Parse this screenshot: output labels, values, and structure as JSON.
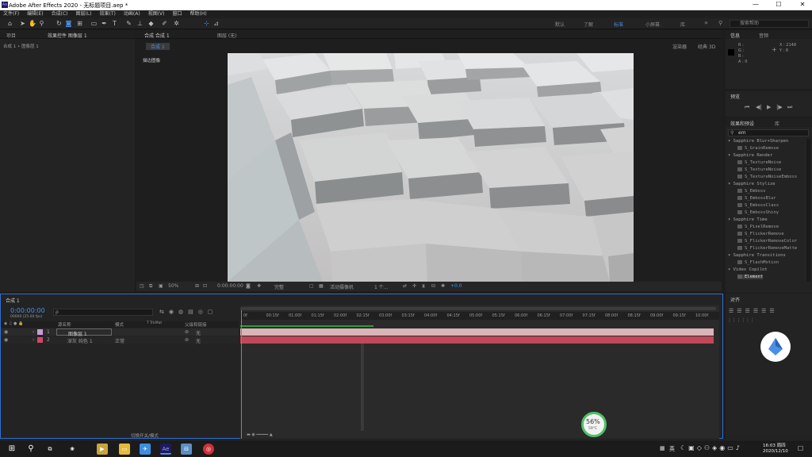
{
  "app": {
    "title": "Adobe After Effects 2020 - 无标题项目.aep *",
    "icon_text": "Ae",
    "minimize": "—",
    "maximize": "☐",
    "close": "✕"
  },
  "menu": [
    "文件(F)",
    "编辑(E)",
    "合成(C)",
    "图层(L)",
    "效果(T)",
    "动画(A)",
    "视图(V)",
    "窗口",
    "帮助(H)"
  ],
  "workspaces": [
    "默认",
    "了解",
    "标准",
    "小屏幕",
    "库"
  ],
  "search_help": {
    "placeholder": "搜索帮助"
  },
  "project": {
    "tab": "项目",
    "tab2": "效果控件 图像层 1",
    "breadcrumb": "合成 1 • 图像层 1"
  },
  "comp": {
    "tab_comp": "合成 合成 1",
    "tab_layer": "图层 (无)",
    "pill": "合成 1",
    "renderer_label": "渲染器",
    "renderer_value": "经典 3D",
    "layer_label": "描边图像"
  },
  "viewer_bar": {
    "zoom": "50%",
    "timecode": "0:00:00:00",
    "resolution": "完整",
    "camera": "活动摄像机",
    "views": "1 个...",
    "exposure": "+0.0"
  },
  "info": {
    "tab": "信息",
    "tab2": "音频",
    "r": "R :",
    "g": "G :",
    "b": "B :",
    "a": "A : 0",
    "x": "X : 2148",
    "y": "Y : 8"
  },
  "preview": {
    "tab": "预览"
  },
  "effects": {
    "tab": "效果和预设",
    "tab2": "库",
    "search_value": "em",
    "items": [
      {
        "type": "cat",
        "label": "Sapphire Blur+Sharpen"
      },
      {
        "type": "sub",
        "label": "S_GrainRemove"
      },
      {
        "type": "cat",
        "label": "Sapphire Render"
      },
      {
        "type": "sub",
        "label": "S_TextureNoise"
      },
      {
        "type": "sub",
        "label": "S_TextureNoise"
      },
      {
        "type": "sub",
        "label": "S_TextureNoiseEmboss"
      },
      {
        "type": "cat",
        "label": "Sapphire Stylize"
      },
      {
        "type": "sub",
        "label": "S_Emboss"
      },
      {
        "type": "sub",
        "label": "S_EmbossBlur"
      },
      {
        "type": "sub",
        "label": "S_EmbossClass"
      },
      {
        "type": "sub",
        "label": "S_EmbossShiny"
      },
      {
        "type": "cat",
        "label": "Sapphire Time"
      },
      {
        "type": "sub",
        "label": "S_PixelRemove"
      },
      {
        "type": "sub",
        "label": "S_FlickerRemove"
      },
      {
        "type": "sub",
        "label": "S_FlickerRemoveColor"
      },
      {
        "type": "sub",
        "label": "S_FlickerRemoveMatte"
      },
      {
        "type": "cat",
        "label": "Sapphire Transitions"
      },
      {
        "type": "sub",
        "label": "S_FlashMotion"
      },
      {
        "type": "cat",
        "label": "Video Copilot"
      },
      {
        "type": "sub",
        "label": "Element"
      }
    ]
  },
  "align": {
    "tab": "对齐"
  },
  "timeline": {
    "tab": "合成 1",
    "timecode": "0:00:00:00",
    "timecode_sub": "00000 (25.00 fps)",
    "search_placeholder": "ρ",
    "col_name": "源名称",
    "col_mode": "模式",
    "col_trkmat": "T TrkMat",
    "col_parent": "父级和链接",
    "layers": [
      {
        "num": "1",
        "name": "图像层 1",
        "mode": "",
        "parent": "无",
        "color": "#c99ad6",
        "bar": "#d9b4b8"
      },
      {
        "num": "2",
        "name": "深灰 纯色 1",
        "mode": "正常",
        "parent": "无",
        "color": "#d64563",
        "bar": "#c04858"
      }
    ],
    "ruler": [
      "0f",
      "00:15f",
      "01:00f",
      "01:15f",
      "02:00f",
      "02:15f",
      "03:00f",
      "03:15f",
      "04:00f",
      "04:15f",
      "05:00f",
      "05:15f",
      "06:00f",
      "06:15f",
      "07:00f",
      "07:15f",
      "08:00f",
      "08:15f",
      "09:00f",
      "09:15f",
      "10:00f"
    ],
    "bottom_label": "切换开关/模式"
  },
  "perf": {
    "percent": "56%",
    "temp": "59°C"
  },
  "taskbar": {
    "ime": "英",
    "time": "16:03 周四",
    "date": "2020/12/10"
  }
}
